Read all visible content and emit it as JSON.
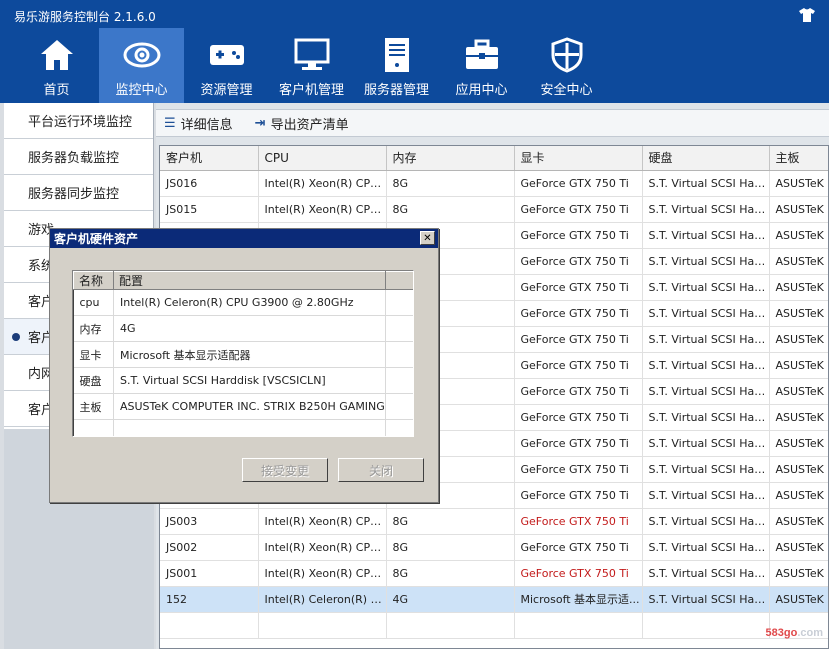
{
  "app": {
    "title": "易乐游服务控制台 2.1.6.0",
    "skin_icon": "shirt-icon"
  },
  "nav": [
    {
      "label": "首页",
      "icon": "home-icon"
    },
    {
      "label": "监控中心",
      "icon": "eye-icon",
      "active": true
    },
    {
      "label": "资源管理",
      "icon": "gamepad-icon"
    },
    {
      "label": "客户机管理",
      "icon": "monitor-icon"
    },
    {
      "label": "服务器管理",
      "icon": "server-icon"
    },
    {
      "label": "应用中心",
      "icon": "toolbox-icon"
    },
    {
      "label": "安全中心",
      "icon": "shield-icon"
    }
  ],
  "sidebar": {
    "items": [
      {
        "label": "平台运行环境监控"
      },
      {
        "label": "服务器负载监控"
      },
      {
        "label": "服务器同步监控"
      },
      {
        "label": "游戏..."
      },
      {
        "label": "系统..."
      },
      {
        "label": "客户..."
      },
      {
        "label": "客户...",
        "active": true
      },
      {
        "label": "内网..."
      },
      {
        "label": "客户..."
      }
    ]
  },
  "toolbar": {
    "details_label": "详细信息",
    "export_label": "导出资产清单"
  },
  "grid": {
    "columns": [
      "客户机",
      "CPU",
      "内存",
      "显卡",
      "硬盘",
      "主板"
    ],
    "rows": [
      [
        "JS016",
        "Intel(R) Xeon(R) CPU E...",
        "8G",
        "GeForce GTX 750 Ti",
        "S.T. Virtual SCSI Hard...",
        "ASUSTeK CO"
      ],
      [
        "JS015",
        "Intel(R) Xeon(R) CPU E...",
        "8G",
        "GeForce GTX 750 Ti",
        "S.T. Virtual SCSI Hard...",
        "ASUSTeK CO"
      ],
      [
        "",
        "",
        "",
        "GeForce GTX 750 Ti",
        "S.T. Virtual SCSI Hard...",
        "ASUSTeK CO"
      ],
      [
        "",
        "",
        "",
        "GeForce GTX 750 Ti",
        "S.T. Virtual SCSI Hard...",
        "ASUSTeK CO"
      ],
      [
        "",
        "",
        "",
        "GeForce GTX 750 Ti",
        "S.T. Virtual SCSI Hard...",
        "ASUSTeK CO"
      ],
      [
        "",
        "",
        "",
        "GeForce GTX 750 Ti",
        "S.T. Virtual SCSI Hard...",
        "ASUSTeK CO"
      ],
      [
        "",
        "",
        "",
        "GeForce GTX 750 Ti",
        "S.T. Virtual SCSI Hard...",
        "ASUSTeK CO"
      ],
      [
        "",
        "",
        "",
        "GeForce GTX 750 Ti",
        "S.T. Virtual SCSI Hard...",
        "ASUSTeK CO"
      ],
      [
        "",
        "",
        "",
        "GeForce GTX 750 Ti",
        "S.T. Virtual SCSI Hard...",
        "ASUSTeK CO"
      ],
      [
        "",
        "",
        "",
        "GeForce GTX 750 Ti",
        "S.T. Virtual SCSI Hard...",
        "ASUSTeK CO"
      ],
      [
        "",
        "",
        "",
        "GeForce GTX 750 Ti",
        "S.T. Virtual SCSI Hard...",
        "ASUSTeK CO"
      ],
      [
        "",
        "",
        "",
        "GeForce GTX 750 Ti",
        "S.T. Virtual SCSI Hard...",
        "ASUSTeK CO"
      ],
      [
        "",
        "",
        "",
        "GeForce GTX 750 Ti",
        "S.T. Virtual SCSI Hard...",
        "ASUSTeK CO"
      ],
      [
        "JS003",
        "Intel(R) Xeon(R) CPU E...",
        "8G",
        "GeForce GTX 750 Ti",
        "S.T. Virtual SCSI Hard...",
        "ASUSTeK CO"
      ],
      [
        "JS002",
        "Intel(R) Xeon(R) CPU E...",
        "8G",
        "GeForce GTX 750 Ti",
        "S.T. Virtual SCSI Hard...",
        "ASUSTeK CO"
      ],
      [
        "JS001",
        "Intel(R) Xeon(R) CPU E...",
        "8G",
        "GeForce GTX 750 Ti",
        "S.T. Virtual SCSI Hard...",
        "ASUSTeK CO"
      ],
      [
        "152",
        "Intel(R) Celeron(R) CP...",
        "4G",
        "Microsoft 基本显示适...",
        "S.T. Virtual SCSI Hard...",
        "ASUSTeK CO"
      ],
      [
        "",
        "",
        "",
        "",
        "",
        ""
      ]
    ],
    "red_gpu_rows": [
      13,
      15
    ],
    "selected_row": 16
  },
  "dialog": {
    "title": "客户机硬件资产",
    "columns": [
      "名称",
      "配置"
    ],
    "rows": [
      [
        "cpu",
        "Intel(R) Celeron(R) CPU G3900 @ 2.80GHz"
      ],
      [
        "内存",
        "4G"
      ],
      [
        "显卡",
        "Microsoft 基本显示适配器"
      ],
      [
        "硬盘",
        "S.T. Virtual SCSI Harddisk [VSCSICLN]"
      ],
      [
        "主板",
        "ASUSTeK COMPUTER INC. STRIX B250H GAMING"
      ],
      [
        "",
        ""
      ]
    ],
    "accept_label": "接受变更",
    "close_label": "关闭"
  },
  "watermark": {
    "brand": "583go",
    "suffix": ".com"
  },
  "colors": {
    "header_bg": "#0d4a9c",
    "nav_active": "#3c77c9",
    "red_text": "#c21a1a",
    "selected_row": "#cde2f7",
    "dialog_title": "#0b2a78"
  }
}
